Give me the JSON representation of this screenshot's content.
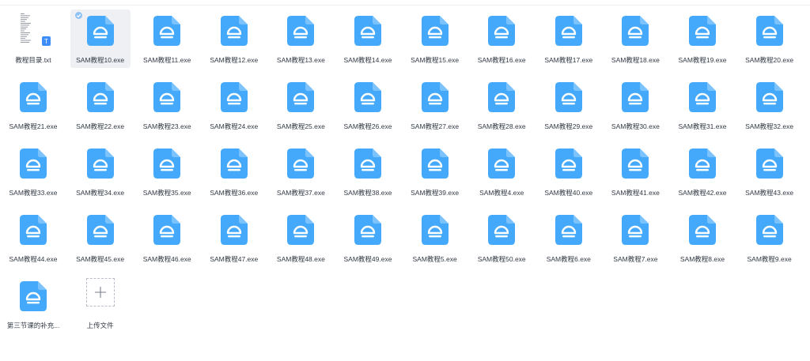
{
  "colors": {
    "exe_icon": "#45a9fb",
    "exe_glyph": "#ffffff",
    "selected_bg": "#eef0f4",
    "txt_badge": "#3d8cf7"
  },
  "icons": {
    "exe": "exe-file-icon",
    "txt": "txt-file-icon",
    "upload": "plus-icon",
    "check": "check-circle-icon"
  },
  "txt_badge_letter": "T",
  "selected_index": 1,
  "files": [
    {
      "name": "教程目录.txt",
      "type": "txt"
    },
    {
      "name": "SAM教程10.exe",
      "type": "exe"
    },
    {
      "name": "SAM教程11.exe",
      "type": "exe"
    },
    {
      "name": "SAM教程12.exe",
      "type": "exe"
    },
    {
      "name": "SAM教程13.exe",
      "type": "exe"
    },
    {
      "name": "SAM教程14.exe",
      "type": "exe"
    },
    {
      "name": "SAM教程15.exe",
      "type": "exe"
    },
    {
      "name": "SAM教程16.exe",
      "type": "exe"
    },
    {
      "name": "SAM教程17.exe",
      "type": "exe"
    },
    {
      "name": "SAM教程18.exe",
      "type": "exe"
    },
    {
      "name": "SAM教程19.exe",
      "type": "exe"
    },
    {
      "name": "SAM教程20.exe",
      "type": "exe"
    },
    {
      "name": "SAM教程21.exe",
      "type": "exe"
    },
    {
      "name": "SAM教程22.exe",
      "type": "exe"
    },
    {
      "name": "SAM教程23.exe",
      "type": "exe"
    },
    {
      "name": "SAM教程24.exe",
      "type": "exe"
    },
    {
      "name": "SAM教程25.exe",
      "type": "exe"
    },
    {
      "name": "SAM教程26.exe",
      "type": "exe"
    },
    {
      "name": "SAM教程27.exe",
      "type": "exe"
    },
    {
      "name": "SAM教程28.exe",
      "type": "exe"
    },
    {
      "name": "SAM教程29.exe",
      "type": "exe"
    },
    {
      "name": "SAM教程30.exe",
      "type": "exe"
    },
    {
      "name": "SAM教程31.exe",
      "type": "exe"
    },
    {
      "name": "SAM教程32.exe",
      "type": "exe"
    },
    {
      "name": "SAM教程33.exe",
      "type": "exe"
    },
    {
      "name": "SAM教程34.exe",
      "type": "exe"
    },
    {
      "name": "SAM教程35.exe",
      "type": "exe"
    },
    {
      "name": "SAM教程36.exe",
      "type": "exe"
    },
    {
      "name": "SAM教程37.exe",
      "type": "exe"
    },
    {
      "name": "SAM教程38.exe",
      "type": "exe"
    },
    {
      "name": "SAM教程39.exe",
      "type": "exe"
    },
    {
      "name": "SAM教程4.exe",
      "type": "exe"
    },
    {
      "name": "SAM教程40.exe",
      "type": "exe"
    },
    {
      "name": "SAM教程41.exe",
      "type": "exe"
    },
    {
      "name": "SAM教程42.exe",
      "type": "exe"
    },
    {
      "name": "SAM教程43.exe",
      "type": "exe"
    },
    {
      "name": "SAM教程44.exe",
      "type": "exe"
    },
    {
      "name": "SAM教程45.exe",
      "type": "exe"
    },
    {
      "name": "SAM教程46.exe",
      "type": "exe"
    },
    {
      "name": "SAM教程47.exe",
      "type": "exe"
    },
    {
      "name": "SAM教程48.exe",
      "type": "exe"
    },
    {
      "name": "SAM教程49.exe",
      "type": "exe"
    },
    {
      "name": "SAM教程5.exe",
      "type": "exe"
    },
    {
      "name": "SAM教程50.exe",
      "type": "exe"
    },
    {
      "name": "SAM教程6.exe",
      "type": "exe"
    },
    {
      "name": "SAM教程7.exe",
      "type": "exe"
    },
    {
      "name": "SAM教程8.exe",
      "type": "exe"
    },
    {
      "name": "SAM教程9.exe",
      "type": "exe"
    },
    {
      "name": "第三节课的补充...",
      "type": "exe"
    }
  ],
  "upload": {
    "label": "上传文件"
  }
}
